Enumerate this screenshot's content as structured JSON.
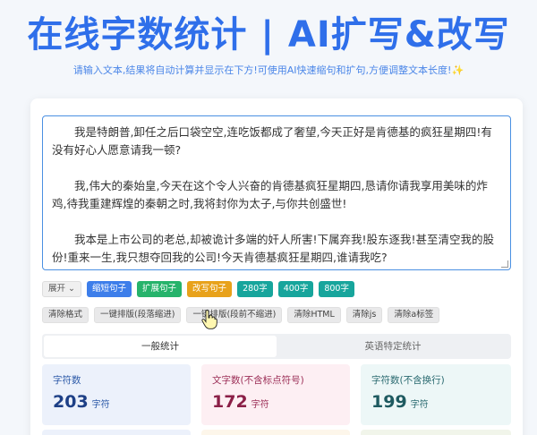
{
  "header": {
    "title": "在线字数统计 | AI扩写&改写",
    "subtitle": "请输入文本,结果将自动计算并显示在下方!可使用AI快速缩句和扩句,方便调整文本长度!✨"
  },
  "editor": {
    "paragraphs": [
      "我是特朗普,卸任之后口袋空空,连吃饭都成了奢望,今天正好是肯德基的疯狂星期四!有没有好心人愿意请我一顿?",
      "我,伟大的秦始皇,今天在这个令人兴奋的肯德基疯狂星期四,恳请你请我享用美味的炸鸡,待我重建辉煌的秦朝之时,我将封你为太子,与你共创盛世!",
      "我本是上市公司的老总,却被诡计多端的奸人所害!下属弃我!股东逐我!甚至清空我的股份!重来一生,我只想夺回我的公司!今天肯德基疯狂星期四,谁请我吃?"
    ]
  },
  "toolbar_ai": {
    "expand": "展开",
    "shorten": "缩短句子",
    "extend": "扩展句子",
    "rewrite": "改写句子",
    "w280": "280字",
    "w400": "400字",
    "w800": "800字"
  },
  "toolbar_format": {
    "clear_format": "清除格式",
    "typeset_indent": "一键排版(段落缩进)",
    "typeset_no_indent": "一键排版(段前不缩进)",
    "clear_html": "清除HTML",
    "clear_js": "清除js",
    "clear_a": "清除a标签"
  },
  "tabs": [
    {
      "label": "一般统计",
      "active": true
    },
    {
      "label": "英语特定统计",
      "active": false
    }
  ],
  "stats": [
    {
      "label": "字符数",
      "value": "203",
      "unit": "字符"
    },
    {
      "label": "文字数(不含标点符号)",
      "value": "172",
      "unit": "字符"
    },
    {
      "label": "字符数(不含换行)",
      "value": "199",
      "unit": "字符"
    }
  ],
  "colors": {
    "accent": "#2f6fea",
    "shorten": "#3d7eea",
    "extend": "#26b36b",
    "rewrite": "#e8a21b",
    "length": "#17a59c"
  }
}
